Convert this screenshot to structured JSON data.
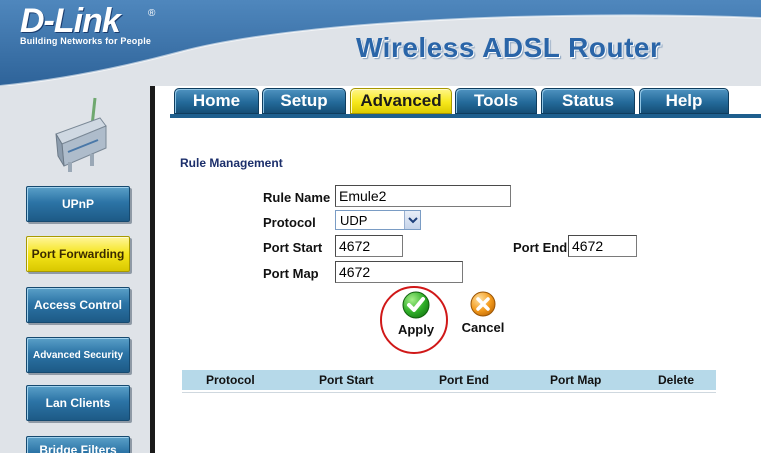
{
  "header": {
    "brand_name": "D-Link",
    "brand_registered": "®",
    "brand_tagline": "Building Networks for People",
    "product_title": "Wireless ADSL Router"
  },
  "tabs": [
    {
      "label": "Home",
      "active": false
    },
    {
      "label": "Setup",
      "active": false
    },
    {
      "label": "Advanced",
      "active": true
    },
    {
      "label": "Tools",
      "active": false
    },
    {
      "label": "Status",
      "active": false
    },
    {
      "label": "Help",
      "active": false
    }
  ],
  "sidebar": {
    "items": [
      {
        "label": "UPnP",
        "active": false
      },
      {
        "label": "Port Forwarding",
        "active": true
      },
      {
        "label": "Access Control",
        "active": false
      },
      {
        "label": "Advanced Security",
        "active": false
      },
      {
        "label": "Lan Clients",
        "active": false
      },
      {
        "label": "Bridge Filters",
        "active": false
      }
    ]
  },
  "main": {
    "section_title": "Rule Management",
    "form": {
      "rule_name_label": "Rule Name",
      "rule_name_value": "Emule2",
      "protocol_label": "Protocol",
      "protocol_value": "UDP",
      "port_start_label": "Port Start",
      "port_start_value": "4672",
      "port_end_label": "Port End",
      "port_end_value": "4672",
      "port_map_label": "Port Map",
      "port_map_value": "4672"
    },
    "actions": {
      "apply_label": "Apply",
      "cancel_label": "Cancel"
    },
    "table": {
      "columns": [
        "Protocol",
        "Port Start",
        "Port End",
        "Port Map",
        "Delete"
      ],
      "rows": []
    }
  },
  "colors": {
    "header_blue": "#2a65a8",
    "tab_blue": "#246a9a",
    "active_yellow": "#f7e81c",
    "table_header": "#b6d9e9",
    "highlight_red": "#d01818"
  },
  "icons": {
    "apply": "green-check-icon",
    "cancel": "orange-x-icon"
  }
}
